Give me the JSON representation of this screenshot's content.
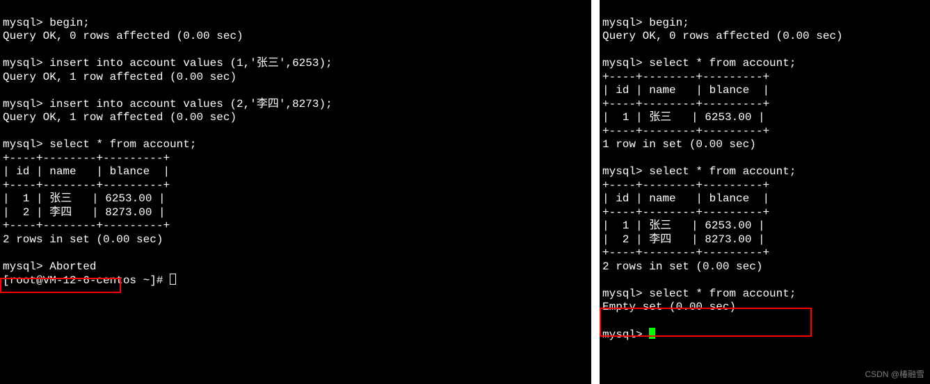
{
  "left": {
    "l1": "mysql> begin;",
    "l2": "Query OK, 0 rows affected (0.00 sec)",
    "l3": "",
    "l4": "mysql> insert into account values (1,'张三',6253);",
    "l5": "Query OK, 1 row affected (0.00 sec)",
    "l6": "",
    "l7": "mysql> insert into account values (2,'李四',8273);",
    "l8": "Query OK, 1 row affected (0.00 sec)",
    "l9": "",
    "l10": "mysql> select * from account;",
    "l11": "+----+--------+---------+",
    "l12": "| id | name   | blance  |",
    "l13": "+----+--------+---------+",
    "l14": "|  1 | 张三   | 6253.00 |",
    "l15": "|  2 | 李四   | 8273.00 |",
    "l16": "+----+--------+---------+",
    "l17": "2 rows in set (0.00 sec)",
    "l18": "",
    "l19": "mysql> Aborted",
    "l20": "[root@VM-12-6-centos ~]# "
  },
  "right": {
    "l1": "mysql> begin;",
    "l2": "Query OK, 0 rows affected (0.00 sec)",
    "l3": "",
    "l4": "mysql> select * from account;",
    "l5": "+----+--------+---------+",
    "l6": "| id | name   | blance  |",
    "l7": "+----+--------+---------+",
    "l8": "|  1 | 张三   | 6253.00 |",
    "l9": "+----+--------+---------+",
    "l10": "1 row in set (0.00 sec)",
    "l11": "",
    "l12": "mysql> select * from account;",
    "l13": "+----+--------+---------+",
    "l14": "| id | name   | blance  |",
    "l15": "+----+--------+---------+",
    "l16": "|  1 | 张三   | 6253.00 |",
    "l17": "|  2 | 李四   | 8273.00 |",
    "l18": "+----+--------+---------+",
    "l19": "2 rows in set (0.00 sec)",
    "l20": "",
    "l21": "mysql> select * from account;",
    "l22": "Empty set (0.00 sec)",
    "l23": "",
    "l24": "mysql> "
  },
  "watermark": "CSDN @椿融雪"
}
